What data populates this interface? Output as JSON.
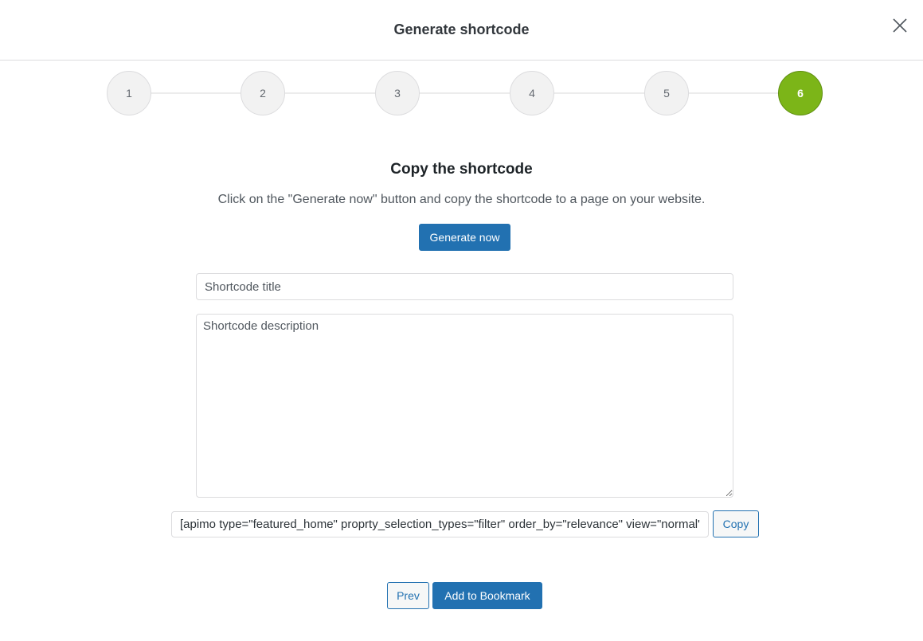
{
  "header": {
    "title": "Generate shortcode",
    "close_icon": "close-icon"
  },
  "steps": [
    {
      "label": "1",
      "active": false
    },
    {
      "label": "2",
      "active": false
    },
    {
      "label": "3",
      "active": false
    },
    {
      "label": "4",
      "active": false
    },
    {
      "label": "5",
      "active": false
    },
    {
      "label": "6",
      "active": true
    }
  ],
  "content": {
    "title": "Copy the shortcode",
    "description": "Click on the \"Generate now\" button and copy the shortcode to a page on your website.",
    "generate_label": "Generate now",
    "title_placeholder": "Shortcode title",
    "description_placeholder": "Shortcode description",
    "shortcode_value": "[apimo type=\"featured_home\" proprty_selection_types=\"filter\" order_by=\"relevance\" view=\"normal\"]",
    "copy_label": "Copy"
  },
  "footer": {
    "prev_label": "Prev",
    "bookmark_label": "Add to Bookmark"
  },
  "colors": {
    "accent": "#2271b1",
    "active_step": "#7cb518"
  }
}
